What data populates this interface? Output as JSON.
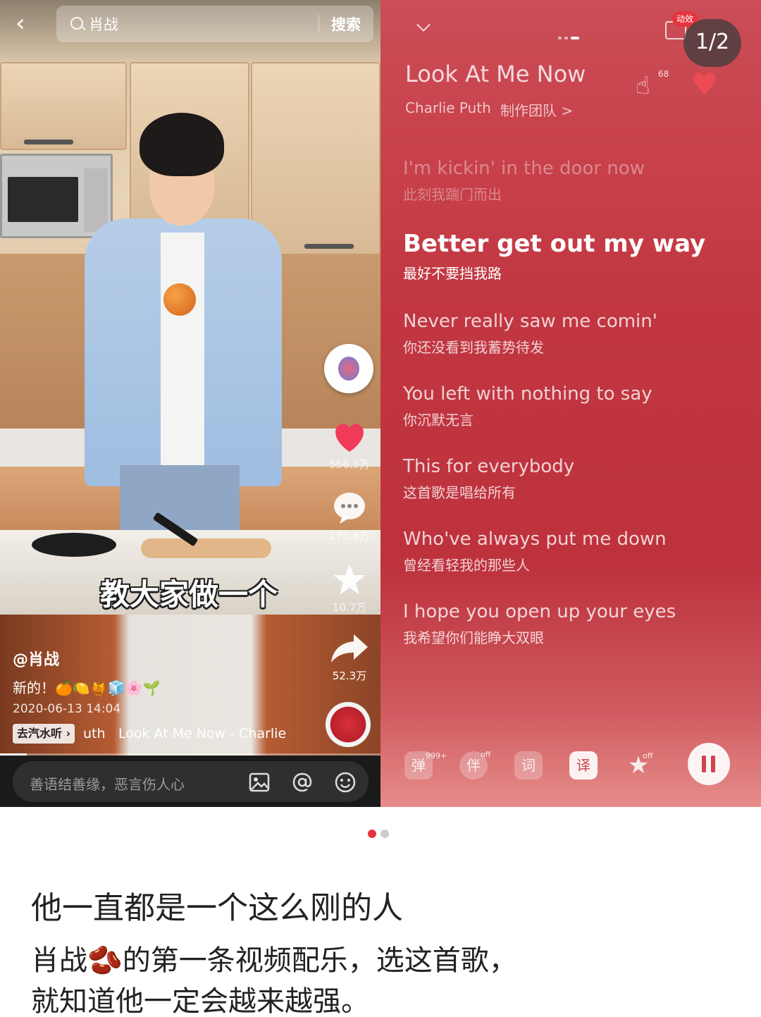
{
  "search": {
    "query": "肖战",
    "button": "搜索"
  },
  "video": {
    "subtitle": "教大家做一个",
    "author": "@肖战",
    "caption": "新的！🍊🍋🍯🧊🌸🌱",
    "date": "2020-06-13 14:04",
    "qishui_button": "去汽水听",
    "track_fragment": "uth",
    "track_name": "Look At Me Now - Charlie",
    "progress": 0.07,
    "likes": "556.3万",
    "comments": "270.6万",
    "favorites": "10.7万",
    "shares": "52.3万",
    "comment_placeholder": "善语结善缘，恶言伤人心"
  },
  "player": {
    "page_counter": "1/2",
    "effect_badge": "动效",
    "song_title": "Look At Me Now",
    "artist": "Charlie Puth",
    "team_link": "制作团队 >",
    "like_count": "68",
    "lyrics": [
      {
        "en": "I'm kickin' in the door now",
        "zh": "此刻我踹门而出",
        "state": "past"
      },
      {
        "en": "Better get out my way",
        "zh": "最好不要挡我路",
        "state": "active"
      },
      {
        "en": "Never really saw me comin'",
        "zh": "你还没看到我蓄势待发",
        "state": "upcoming"
      },
      {
        "en": "You left with nothing to say",
        "zh": "你沉默无言",
        "state": "upcoming"
      },
      {
        "en": "This for everybody",
        "zh": "这首歌是唱给所有",
        "state": "upcoming"
      },
      {
        "en": "Who've always put me down",
        "zh": "曾经看轻我的那些人",
        "state": "upcoming"
      },
      {
        "en": "I hope you open up your eyes",
        "zh": "我希望你们能睁大双眼",
        "state": "upcoming"
      }
    ],
    "controls": {
      "danmaku": "弹",
      "danmaku_count": "999+",
      "accompany": "伴",
      "accompany_state": "off",
      "lyric": "词",
      "translate": "译",
      "star_state": "off"
    }
  },
  "post": {
    "title": "他一直都是一个这么刚的人",
    "body_line1": "肖战🫘的第一条视频配乐，选这首歌，",
    "body_line2": "就知道他一定会越来越强。"
  }
}
